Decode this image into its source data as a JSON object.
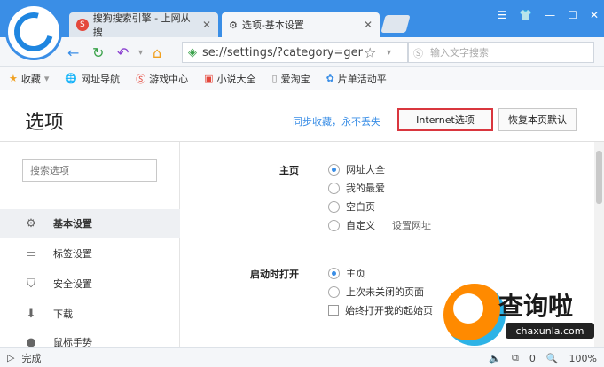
{
  "browser": {
    "tabs": [
      {
        "title": "搜狗搜索引擎 - 上网从搜"
      },
      {
        "title": "选项-基本设置"
      }
    ],
    "address": "se://settings/?category=ger",
    "search_placeholder": "输入文字搜索",
    "status_text": "完成",
    "zoom": "100%",
    "status_count": "0"
  },
  "bookmarks": [
    {
      "label": "收藏",
      "icon": "star-icon"
    },
    {
      "label": "网址导航",
      "icon": "globe-icon"
    },
    {
      "label": "游戏中心",
      "icon": "sogou-icon"
    },
    {
      "label": "小说大全",
      "icon": "book-icon"
    },
    {
      "label": "爱淘宝",
      "icon": "document-icon"
    },
    {
      "label": "片单活动平",
      "icon": "paw-icon"
    }
  ],
  "header": {
    "title": "选项",
    "sync_link": "同步收藏，永不丢失",
    "internet_button": "Internet选项",
    "restore_button": "恢复本页默认"
  },
  "sidebar": {
    "search_placeholder": "搜索选项",
    "items": [
      {
        "label": "基本设置",
        "icon": "gear-icon",
        "active": true
      },
      {
        "label": "标签设置",
        "icon": "tab-icon",
        "active": false
      },
      {
        "label": "安全设置",
        "icon": "shield-icon",
        "active": false
      },
      {
        "label": "下载",
        "icon": "download-icon",
        "active": false
      },
      {
        "label": "鼠标手势",
        "icon": "mouse-icon",
        "active": false
      }
    ]
  },
  "settings": {
    "homepage": {
      "label": "主页",
      "options": [
        {
          "label": "网址大全",
          "selected": true
        },
        {
          "label": "我的最爱",
          "selected": false
        },
        {
          "label": "空白页",
          "selected": false
        },
        {
          "label": "自定义",
          "selected": false,
          "link": "设置网址"
        }
      ]
    },
    "startup": {
      "label": "启动时打开",
      "options": [
        {
          "label": "主页",
          "selected": true
        },
        {
          "label": "上次未关闭的页面",
          "selected": false
        }
      ],
      "checkbox": {
        "label": "始终打开我的起始页",
        "checked": false
      }
    }
  },
  "watermark": {
    "text": "查询啦",
    "sub": "chaxunla.com"
  },
  "colors": {
    "accent": "#3a8ee6",
    "highlight_border": "#d9363e"
  }
}
